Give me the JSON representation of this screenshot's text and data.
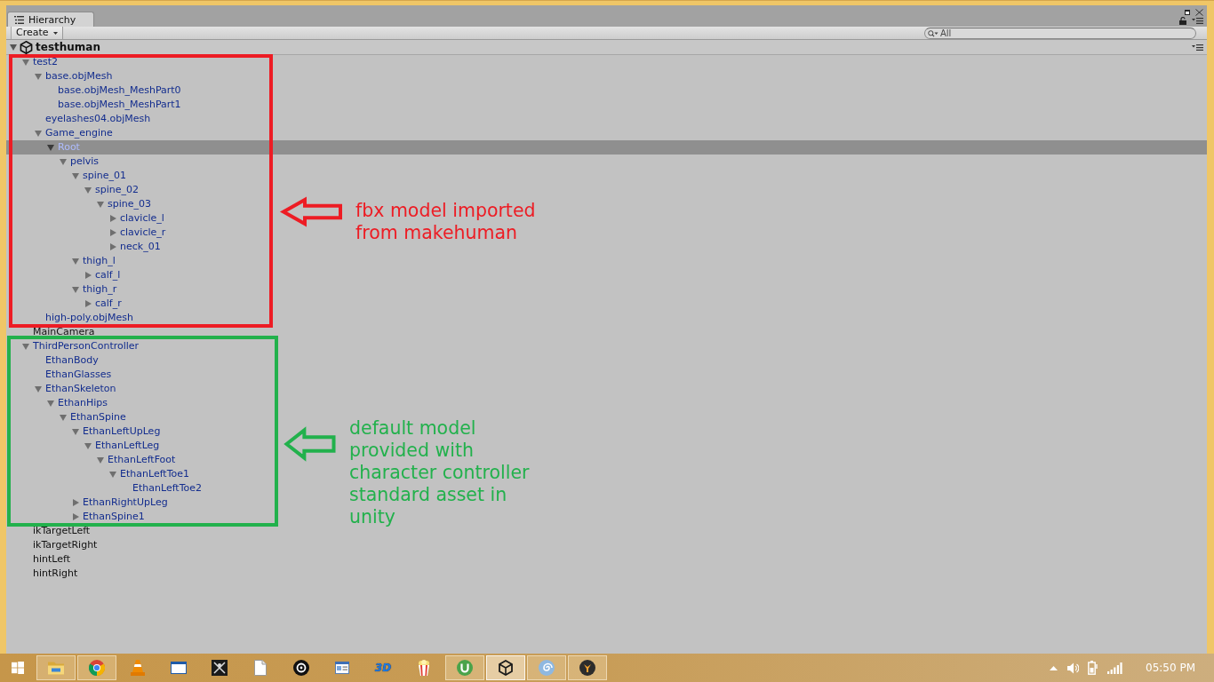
{
  "window": {
    "tab": {
      "label": "Hierarchy",
      "selected": true
    },
    "create_button": "Create",
    "search": {
      "placeholder": "All"
    }
  },
  "scene": {
    "name": "testhuman",
    "expanded": true,
    "items": [
      {
        "name": "test2",
        "kind": "parent",
        "expanded": true,
        "prefab": true,
        "selected": false,
        "children": [
          {
            "name": "base.objMesh",
            "kind": "parent",
            "expanded": true,
            "prefab": true,
            "selected": false,
            "children": [
              {
                "name": "base.objMesh_MeshPart0",
                "kind": "leaf",
                "prefab": true,
                "selected": false
              },
              {
                "name": "base.objMesh_MeshPart1",
                "kind": "leaf",
                "prefab": true,
                "selected": false
              }
            ]
          },
          {
            "name": "eyelashes04.objMesh",
            "kind": "leaf",
            "prefab": true,
            "selected": false
          },
          {
            "name": "Game_engine",
            "kind": "parent",
            "expanded": true,
            "prefab": true,
            "selected": false,
            "children": [
              {
                "name": "Root",
                "kind": "parent",
                "expanded": true,
                "prefab": true,
                "selected": true,
                "children": [
                  {
                    "name": "pelvis",
                    "kind": "parent",
                    "expanded": true,
                    "prefab": true,
                    "selected": false,
                    "children": [
                      {
                        "name": "spine_01",
                        "kind": "parent",
                        "expanded": true,
                        "prefab": true,
                        "selected": false,
                        "children": [
                          {
                            "name": "spine_02",
                            "kind": "parent",
                            "expanded": true,
                            "prefab": true,
                            "selected": false,
                            "children": [
                              {
                                "name": "spine_03",
                                "kind": "parent",
                                "expanded": true,
                                "prefab": true,
                                "selected": false,
                                "children": [
                                  {
                                    "name": "clavicle_l",
                                    "kind": "parent",
                                    "expanded": false,
                                    "prefab": true,
                                    "selected": false
                                  },
                                  {
                                    "name": "clavicle_r",
                                    "kind": "parent",
                                    "expanded": false,
                                    "prefab": true,
                                    "selected": false
                                  },
                                  {
                                    "name": "neck_01",
                                    "kind": "parent",
                                    "expanded": false,
                                    "prefab": true,
                                    "selected": false
                                  }
                                ]
                              }
                            ]
                          }
                        ]
                      },
                      {
                        "name": "thigh_l",
                        "kind": "parent",
                        "expanded": true,
                        "prefab": true,
                        "selected": false,
                        "children": [
                          {
                            "name": "calf_l",
                            "kind": "parent",
                            "expanded": false,
                            "prefab": true,
                            "selected": false
                          }
                        ]
                      },
                      {
                        "name": "thigh_r",
                        "kind": "parent",
                        "expanded": true,
                        "prefab": true,
                        "selected": false,
                        "children": [
                          {
                            "name": "calf_r",
                            "kind": "parent",
                            "expanded": false,
                            "prefab": true,
                            "selected": false
                          }
                        ]
                      }
                    ]
                  }
                ]
              }
            ]
          },
          {
            "name": "high-poly.objMesh",
            "kind": "leaf",
            "prefab": true,
            "selected": false
          }
        ]
      },
      {
        "name": "MainCamera",
        "kind": "leaf",
        "prefab": false,
        "selected": false
      },
      {
        "name": "ThirdPersonController",
        "kind": "parent",
        "expanded": true,
        "prefab": true,
        "selected": false,
        "children": [
          {
            "name": "EthanBody",
            "kind": "leaf",
            "prefab": true,
            "selected": false
          },
          {
            "name": "EthanGlasses",
            "kind": "leaf",
            "prefab": true,
            "selected": false
          },
          {
            "name": "EthanSkeleton",
            "kind": "parent",
            "expanded": true,
            "prefab": true,
            "selected": false,
            "children": [
              {
                "name": "EthanHips",
                "kind": "parent",
                "expanded": true,
                "prefab": true,
                "selected": false,
                "children": [
                  {
                    "name": "EthanSpine",
                    "kind": "parent",
                    "expanded": true,
                    "prefab": true,
                    "selected": false,
                    "children": [
                      {
                        "name": "EthanLeftUpLeg",
                        "kind": "parent",
                        "expanded": true,
                        "prefab": true,
                        "selected": false,
                        "children": [
                          {
                            "name": "EthanLeftLeg",
                            "kind": "parent",
                            "expanded": true,
                            "prefab": true,
                            "selected": false,
                            "children": [
                              {
                                "name": "EthanLeftFoot",
                                "kind": "parent",
                                "expanded": true,
                                "prefab": true,
                                "selected": false,
                                "children": [
                                  {
                                    "name": "EthanLeftToe1",
                                    "kind": "parent",
                                    "expanded": true,
                                    "prefab": true,
                                    "selected": false,
                                    "children": [
                                      {
                                        "name": "EthanLeftToe2",
                                        "kind": "leaf",
                                        "prefab": true,
                                        "selected": false
                                      }
                                    ]
                                  }
                                ]
                              }
                            ]
                          }
                        ]
                      },
                      {
                        "name": "EthanRightUpLeg",
                        "kind": "parent",
                        "expanded": false,
                        "prefab": true,
                        "selected": false
                      },
                      {
                        "name": "EthanSpine1",
                        "kind": "parent",
                        "expanded": false,
                        "prefab": true,
                        "selected": false
                      }
                    ]
                  }
                ]
              }
            ]
          }
        ]
      },
      {
        "name": "ikTargetLeft",
        "kind": "leaf",
        "prefab": false,
        "selected": false
      },
      {
        "name": "ikTargetRight",
        "kind": "leaf",
        "prefab": false,
        "selected": false
      },
      {
        "name": "hintLeft",
        "kind": "leaf",
        "prefab": false,
        "selected": false
      },
      {
        "name": "hintRight",
        "kind": "leaf",
        "prefab": false,
        "selected": false
      }
    ]
  },
  "annotations": [
    {
      "lines": [
        "fbx model imported",
        "from makehuman"
      ],
      "color": "#ed1c24"
    },
    {
      "lines": [
        "default model",
        "provided with",
        "character controller",
        "standard asset in",
        "unity"
      ],
      "color": "#22b14c"
    }
  ],
  "taskbar": {
    "apps": [
      {
        "kind": "folder",
        "open": true,
        "selected": false
      },
      {
        "kind": "pinwheel",
        "open": true,
        "selected": false
      },
      {
        "kind": "cone",
        "open": false,
        "selected": false
      },
      {
        "kind": "window",
        "open": false,
        "selected": false
      },
      {
        "kind": "tile",
        "open": false,
        "selected": false
      },
      {
        "kind": "document",
        "open": false,
        "selected": false
      },
      {
        "kind": "target",
        "open": false,
        "selected": false
      },
      {
        "kind": "card",
        "open": false,
        "selected": false
      },
      {
        "kind": "text",
        "label": "3D",
        "open": false,
        "selected": false
      },
      {
        "kind": "popcorn",
        "open": false,
        "selected": false
      },
      {
        "kind": "disc",
        "open": true,
        "selected": false
      },
      {
        "kind": "cube",
        "open": true,
        "selected": true
      },
      {
        "kind": "swirl",
        "open": true,
        "selected": false
      },
      {
        "kind": "emblem",
        "open": true,
        "selected": false
      }
    ],
    "clock": "05:50 PM"
  }
}
